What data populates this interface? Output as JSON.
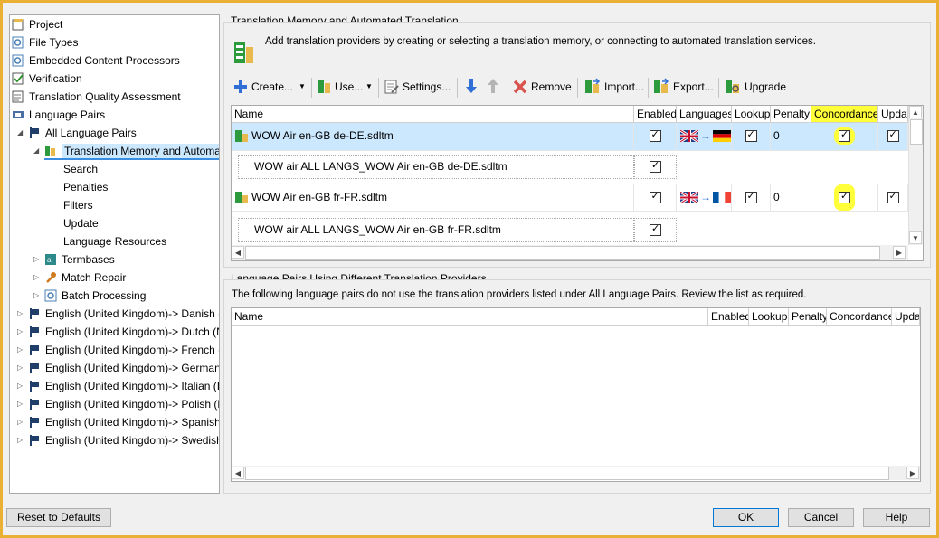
{
  "tree": {
    "items": [
      {
        "label": "Project",
        "icon": "project-icon"
      },
      {
        "label": "File Types",
        "icon": "gear-doc-icon"
      },
      {
        "label": "Embedded Content Processors",
        "icon": "gear-doc-icon"
      },
      {
        "label": "Verification",
        "icon": "verification-icon"
      },
      {
        "label": "Translation Quality Assessment",
        "icon": "tqa-icon"
      },
      {
        "label": "Language Pairs",
        "icon": "language-pairs-icon"
      },
      {
        "label": "All Language Pairs",
        "icon": "flag-icon"
      },
      {
        "label": "Translation Memory and Automated Translation",
        "icon": "tm-icon"
      },
      {
        "label": "Search"
      },
      {
        "label": "Penalties"
      },
      {
        "label": "Filters"
      },
      {
        "label": "Update"
      },
      {
        "label": "Language Resources"
      },
      {
        "label": "Termbases",
        "icon": "termbase-icon"
      },
      {
        "label": "Match Repair",
        "icon": "wrench-icon"
      },
      {
        "label": "Batch Processing",
        "icon": "batch-icon"
      },
      {
        "label": "English (United Kingdom)-> Danish (D",
        "icon": "flag-icon"
      },
      {
        "label": "English (United Kingdom)-> Dutch (N",
        "icon": "flag-icon"
      },
      {
        "label": "English (United Kingdom)-> French (F",
        "icon": "flag-icon"
      },
      {
        "label": "English (United Kingdom)-> German (",
        "icon": "flag-icon"
      },
      {
        "label": "English (United Kingdom)-> Italian (It",
        "icon": "flag-icon"
      },
      {
        "label": "English (United Kingdom)-> Polish (P",
        "icon": "flag-icon"
      },
      {
        "label": "English (United Kingdom)-> Spanish (",
        "icon": "flag-icon"
      },
      {
        "label": "English (United Kingdom)-> Swedish (",
        "icon": "flag-icon"
      }
    ]
  },
  "tm_section": {
    "title": "Translation Memory and Automated Translation",
    "description": "Add translation providers by creating or selecting a translation memory, or connecting to automated translation services.",
    "toolbar": {
      "create": "Create...",
      "use": "Use...",
      "settings": "Settings...",
      "remove": "Remove",
      "import": "Import...",
      "export": "Export...",
      "upgrade": "Upgrade"
    },
    "columns": [
      "Name",
      "Enabled",
      "Languages",
      "Lookup",
      "Penalty",
      "Concordance",
      "Updat"
    ],
    "rows": [
      {
        "name": "WOW Air en-GB de-DE.sdltm",
        "penalty": "0",
        "target_flag": "de-flag-icon",
        "selected": true
      },
      {
        "name": "WOW air ALL LANGS_WOW Air en-GB de-DE.sdltm",
        "child": true
      },
      {
        "name": "WOW Air en-GB fr-FR.sdltm",
        "penalty": "0",
        "target_flag": "fr-flag-icon"
      },
      {
        "name": "WOW air ALL LANGS_WOW Air en-GB fr-FR.sdltm",
        "child": true
      }
    ]
  },
  "lp_section": {
    "title": "Language Pairs Using Different Translation Providers",
    "description": "The following language pairs do not use the translation providers listed under All Language Pairs. Review the list as required.",
    "columns": [
      "Name",
      "Enabled",
      "Lookup",
      "Penalty",
      "Concordance",
      "Upda"
    ]
  },
  "footer": {
    "reset": "Reset to Defaults",
    "ok": "OK",
    "cancel": "Cancel",
    "help": "Help"
  },
  "colors": {
    "selection": "#cce8ff",
    "highlight": "#ffff3a",
    "frame": "#e9b033"
  }
}
